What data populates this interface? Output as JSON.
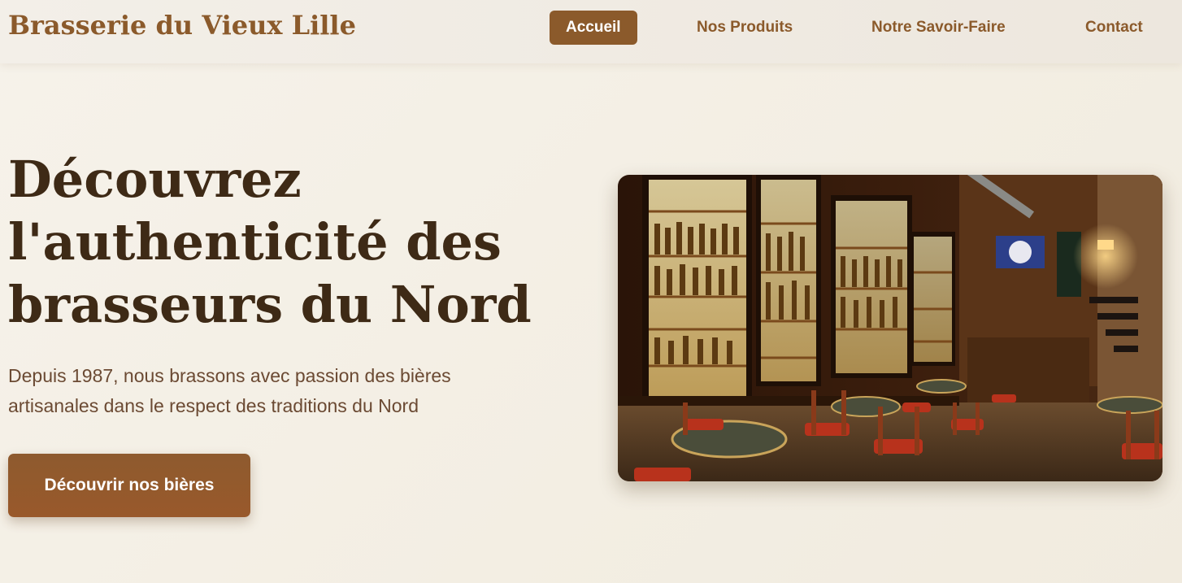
{
  "brand": {
    "name": "Brasserie du Vieux Lille"
  },
  "nav": {
    "items": [
      {
        "label": "Accueil",
        "active": true
      },
      {
        "label": "Nos Produits",
        "active": false
      },
      {
        "label": "Notre Savoir-Faire",
        "active": false
      },
      {
        "label": "Contact",
        "active": false
      }
    ]
  },
  "hero": {
    "title": "Découvrez l'authenticité des brasseurs du Nord",
    "subtitle": "Depuis 1987, nous brassons avec passion des bières artisanales dans le respect des traditions du Nord",
    "cta_label": "Découvrir nos bières",
    "image_icon": "photo-bar-interior"
  },
  "colors": {
    "brand": "#8b5a2b",
    "heading": "#3e2a16",
    "body_text": "#6b4a33",
    "background": "#f5f0e6"
  }
}
